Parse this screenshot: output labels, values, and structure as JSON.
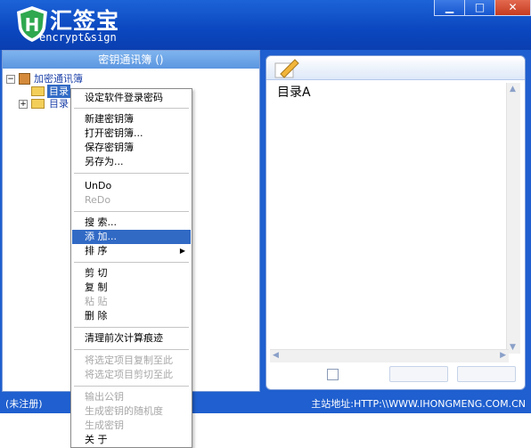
{
  "app": {
    "name": "汇签宝",
    "subtitle": "encrypt&sign",
    "logo_letter": "H"
  },
  "window_controls": {
    "minimize": "▁",
    "maximize": "□",
    "close": "✕"
  },
  "left_panel": {
    "header": "密钥通讯簿 ()",
    "tree": {
      "root_label": "加密通讯簿",
      "root_expander": "−",
      "items": [
        {
          "label": "目录",
          "selected": true
        },
        {
          "label": "目录",
          "expander": "+"
        }
      ]
    }
  },
  "right_panel": {
    "content": "目录A"
  },
  "context_menu": {
    "items": [
      {
        "label": "设定软件登录密码",
        "enabled": true
      },
      {
        "label": "新建密钥簿",
        "enabled": true
      },
      {
        "label": "打开密钥簿...",
        "enabled": true
      },
      {
        "label": "保存密钥簿",
        "enabled": true
      },
      {
        "label": "另存为...",
        "enabled": true
      },
      {
        "label": "UnDo",
        "enabled": true
      },
      {
        "label": "ReDo",
        "enabled": false
      },
      {
        "label": "搜    索...",
        "enabled": true
      },
      {
        "label": "添    加...",
        "enabled": true,
        "selected": true
      },
      {
        "label": "排    序",
        "enabled": true,
        "submenu": true
      },
      {
        "label": "剪    切",
        "enabled": true
      },
      {
        "label": "复    制",
        "enabled": true
      },
      {
        "label": "粘    贴",
        "enabled": false
      },
      {
        "label": "删    除",
        "enabled": true
      },
      {
        "label": "清理前次计算痕迹",
        "enabled": true
      },
      {
        "label": "将选定项目复制至此",
        "enabled": false
      },
      {
        "label": "将选定项目剪切至此",
        "enabled": false
      },
      {
        "label": "输出公钥",
        "enabled": false
      },
      {
        "label": "生成密钥的随机度",
        "enabled": false
      },
      {
        "label": "生成密钥",
        "enabled": false
      },
      {
        "label": "关    于",
        "enabled": true
      }
    ],
    "submenu_arrow": "▶"
  },
  "status_bar": {
    "left": "(未注册)",
    "right": "主站地址:HTTP:\\\\WWW.IHONGMENG.COM.CN"
  },
  "colors": {
    "title_blue": "#0b47bf",
    "menu_highlight": "#316ac5",
    "logo_green": "#2fa84f"
  }
}
